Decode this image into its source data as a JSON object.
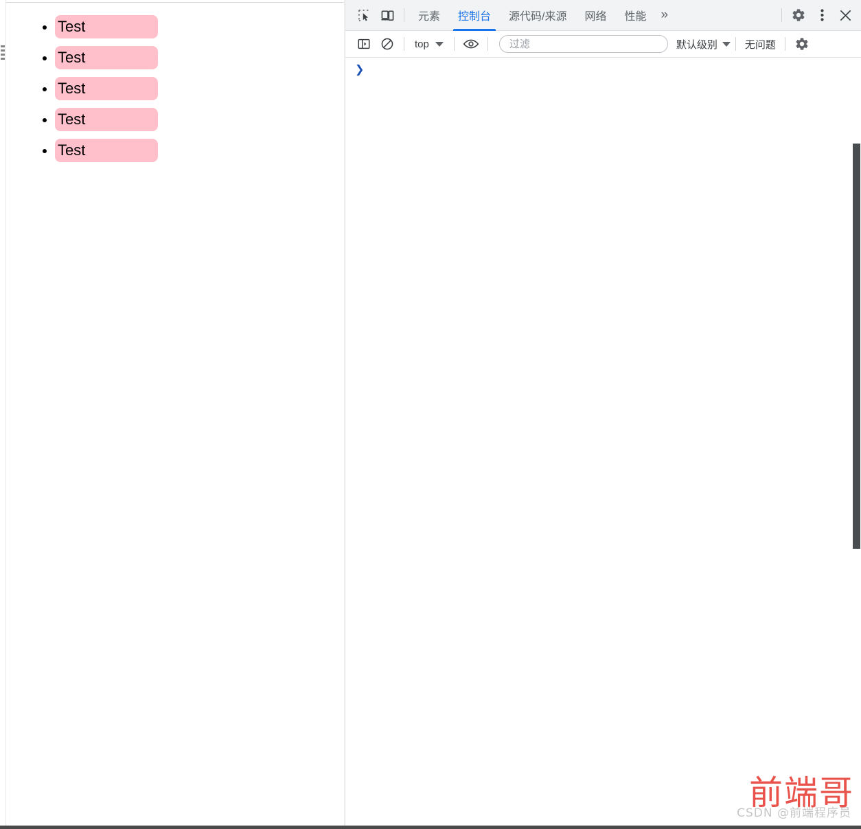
{
  "page": {
    "list_items": [
      {
        "text": "Test"
      },
      {
        "text": "Test"
      },
      {
        "text": "Test"
      },
      {
        "text": "Test"
      },
      {
        "text": "Test"
      }
    ],
    "highlight_color": "#ffc0cb",
    "text_color": "#000000"
  },
  "devtools": {
    "tabbar": {
      "inspect_icon": "inspect-element-icon",
      "device_icon": "device-toolbar-icon",
      "tabs": [
        {
          "label": "元素",
          "active": false
        },
        {
          "label": "控制台",
          "active": true
        },
        {
          "label": "源代码/来源",
          "active": false
        },
        {
          "label": "网络",
          "active": false
        },
        {
          "label": "性能",
          "active": false
        }
      ],
      "overflow_label": "»",
      "settings_icon": "gear-icon",
      "menu_icon": "kebab-menu-icon",
      "close_icon": "close-icon",
      "active_color": "#1a73e8"
    },
    "console_toolbar": {
      "sidebar_toggle_icon": "console-sidebar-icon",
      "clear_icon": "clear-console-icon",
      "context_value": "top",
      "eye_icon": "live-expression-eye-icon",
      "filter_placeholder": "过滤",
      "filter_value": "",
      "level_value": "默认级别",
      "issues_text": "无问题",
      "settings_icon": "gear-icon"
    },
    "console_body": {
      "prompt_symbol": "❯",
      "entries": []
    }
  },
  "watermark": {
    "primary": "前端哥",
    "secondary": "CSDN @前端程序员",
    "primary_color": "#e8453c",
    "secondary_color": "#b9b9b9"
  }
}
